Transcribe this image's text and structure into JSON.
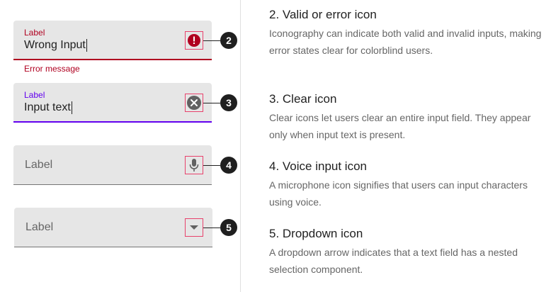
{
  "fields": {
    "error_field": {
      "label": "Label",
      "value": "Wrong Input",
      "helper": "Error message"
    },
    "clear_field": {
      "label": "Label",
      "value": "Input text"
    },
    "voice_field": {
      "label": "Label"
    },
    "dropdown_field": {
      "label": "Label"
    }
  },
  "markers": [
    "2",
    "3",
    "4",
    "5"
  ],
  "sections": [
    {
      "title": "2. Valid or error icon",
      "body": "Iconography can indicate both valid and invalid inputs, making error states clear for colorblind users."
    },
    {
      "title": "3. Clear icon",
      "body": "Clear icons let users clear an entire input field. They appear only when input text is present."
    },
    {
      "title": "4. Voice input icon",
      "body": "A microphone icon signifies that users can input characters using voice."
    },
    {
      "title": "5. Dropdown icon",
      "body": "A dropdown arrow indicates that a text field has a nested selection component."
    }
  ],
  "colors": {
    "error": "#b00020",
    "focus": "#6200ee",
    "highlight": "#e8426c",
    "field_bg": "#e6e6e6"
  }
}
